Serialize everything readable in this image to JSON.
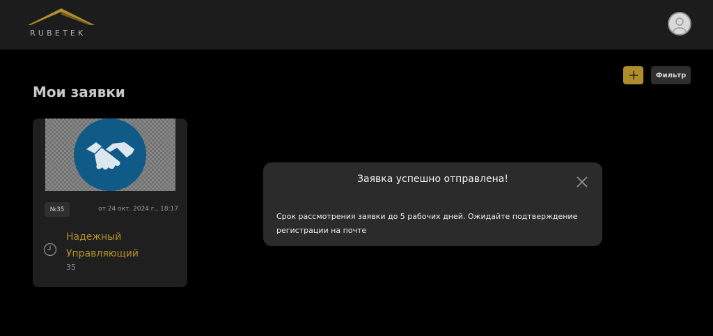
{
  "header": {
    "logo_text": "RUBETEK",
    "brand_color": "#b08d2c",
    "profile_icon": "user-avatar-icon"
  },
  "toolbar": {
    "add_icon": "plus-icon",
    "filter_label": "Фильтр"
  },
  "page": {
    "title": "Мои заявки"
  },
  "cards": [
    {
      "image_icon": "handshake-icon",
      "badge": "№35",
      "date": "от 24 окт. 2024 г., 18:17",
      "status_icon": "clock-icon",
      "name": "Надежный Управляющий",
      "number": "35"
    }
  ],
  "modal": {
    "title": "Заявка успешно отправлена!",
    "message": "Срок рассмотрения заявки до 5 рабочих дней. Ожидайте подтверждение регистрации на почте",
    "close_icon": "close-icon"
  }
}
